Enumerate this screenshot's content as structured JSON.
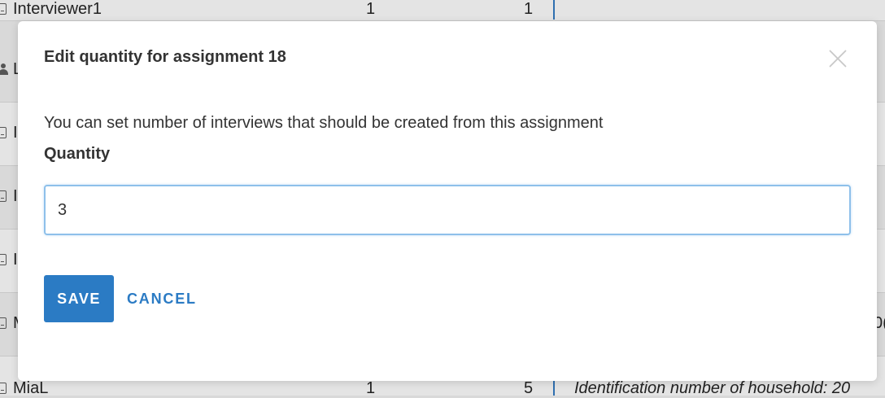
{
  "background": {
    "top_row": {
      "name": "Interviewer1",
      "col1": "1",
      "col2": "1"
    },
    "partial_row_initials": [
      "L",
      "I",
      "I",
      "I",
      "M"
    ],
    "bottom_row": {
      "name": "MiaL",
      "col1": "1",
      "col2": "5",
      "detail": "Identification number of household: 20"
    },
    "side_fragment": "0("
  },
  "modal": {
    "title": "Edit quantity for assignment 18",
    "description": "You can set number of interviews that should be created from this assignment",
    "quantity_label": "Quantity",
    "quantity_value": "3",
    "save_label": "SAVE",
    "cancel_label": "CANCEL"
  },
  "colors": {
    "accent": "#2b7bc4",
    "input_border": "#8ec0ea"
  },
  "icons": [
    "close-icon",
    "document-icon",
    "person-icon"
  ]
}
